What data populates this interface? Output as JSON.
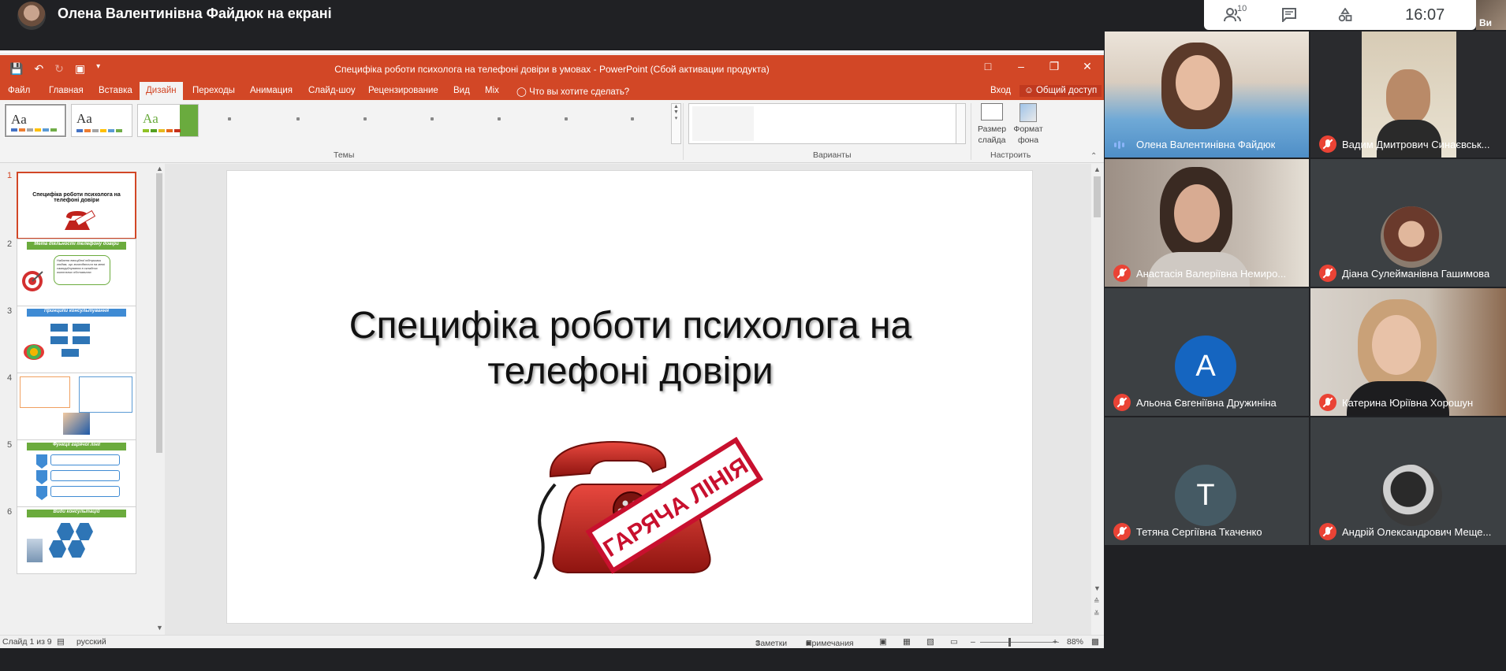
{
  "meet": {
    "presenter_label": "Олена Валентинівна Файдюк на екрані",
    "participants_count": "10",
    "clock": "16:07",
    "self_name": "Ви",
    "colors": {
      "background": "#202124",
      "muted": "#ea4335",
      "speaking": "#8ab4f8"
    }
  },
  "ppt": {
    "window_title": "Специфіка роботи психолога на телефоні довіри в умовах  -  PowerPoint (Сбой активации продукта)",
    "tabs": [
      "Файл",
      "Главная",
      "Вставка",
      "Дизайн",
      "Переходы",
      "Анимация",
      "Слайд-шоу",
      "Рецензирование",
      "Вид",
      "Mix"
    ],
    "active_tab": "Дизайн",
    "tell_me": "Что вы хотите сделать?",
    "sign_in": "Вход",
    "share": "Общий доступ",
    "theme_sample": "Aa",
    "groups": {
      "themes": "Темы",
      "variants": "Варианты",
      "customize": "Настроить"
    },
    "slide_size": "Размер слайда",
    "format_background": "Формат фона",
    "thumbnails": [
      {
        "num": "1",
        "title": "Специфіка роботи психолога на телефоні довіри"
      },
      {
        "num": "2",
        "title": "Мета діяльності телефону довіри",
        "body": "Надання емоційної підтримки людям, що знаходяться на межі саморуйнування в складних життєвих обставинах"
      },
      {
        "num": "3",
        "title": "Принципи консультування"
      },
      {
        "num": "4",
        "title": ""
      },
      {
        "num": "5",
        "title": "Функції гарячої лінії"
      },
      {
        "num": "6",
        "title": "Види консультацій"
      }
    ],
    "slide": {
      "title_line1": "Специфіка роботи психолога на",
      "title_line2": "телефоні довіри",
      "stamp": "ГАРЯЧА ЛІНІЯ"
    },
    "status": {
      "slide_of": "Слайд 1 из 9",
      "language": "русский",
      "notes": "Заметки",
      "comments": "Примечания",
      "zoom": "88%"
    },
    "accent": "#d24726"
  },
  "participants": [
    {
      "name": "Олена Валентинівна Файдюк",
      "muted": false
    },
    {
      "name": "Вадим Дмитрович Синаєвськ...",
      "muted": true
    },
    {
      "name": "Анастасія Валеріївна Немиро...",
      "muted": true
    },
    {
      "name": "Діана Сулейманівна Гашимова",
      "muted": true
    },
    {
      "name": "Альона Євгеніївна Дружиніна",
      "muted": true,
      "initial": "A",
      "avatar_color": "#1565c0"
    },
    {
      "name": "Катерина Юріївна Хорошун",
      "muted": true
    },
    {
      "name": "Тетяна Сергіївна Ткаченко",
      "muted": true,
      "initial": "T",
      "avatar_color": "#455a64"
    },
    {
      "name": "Андрій Олександрович Меще...",
      "muted": true
    }
  ]
}
